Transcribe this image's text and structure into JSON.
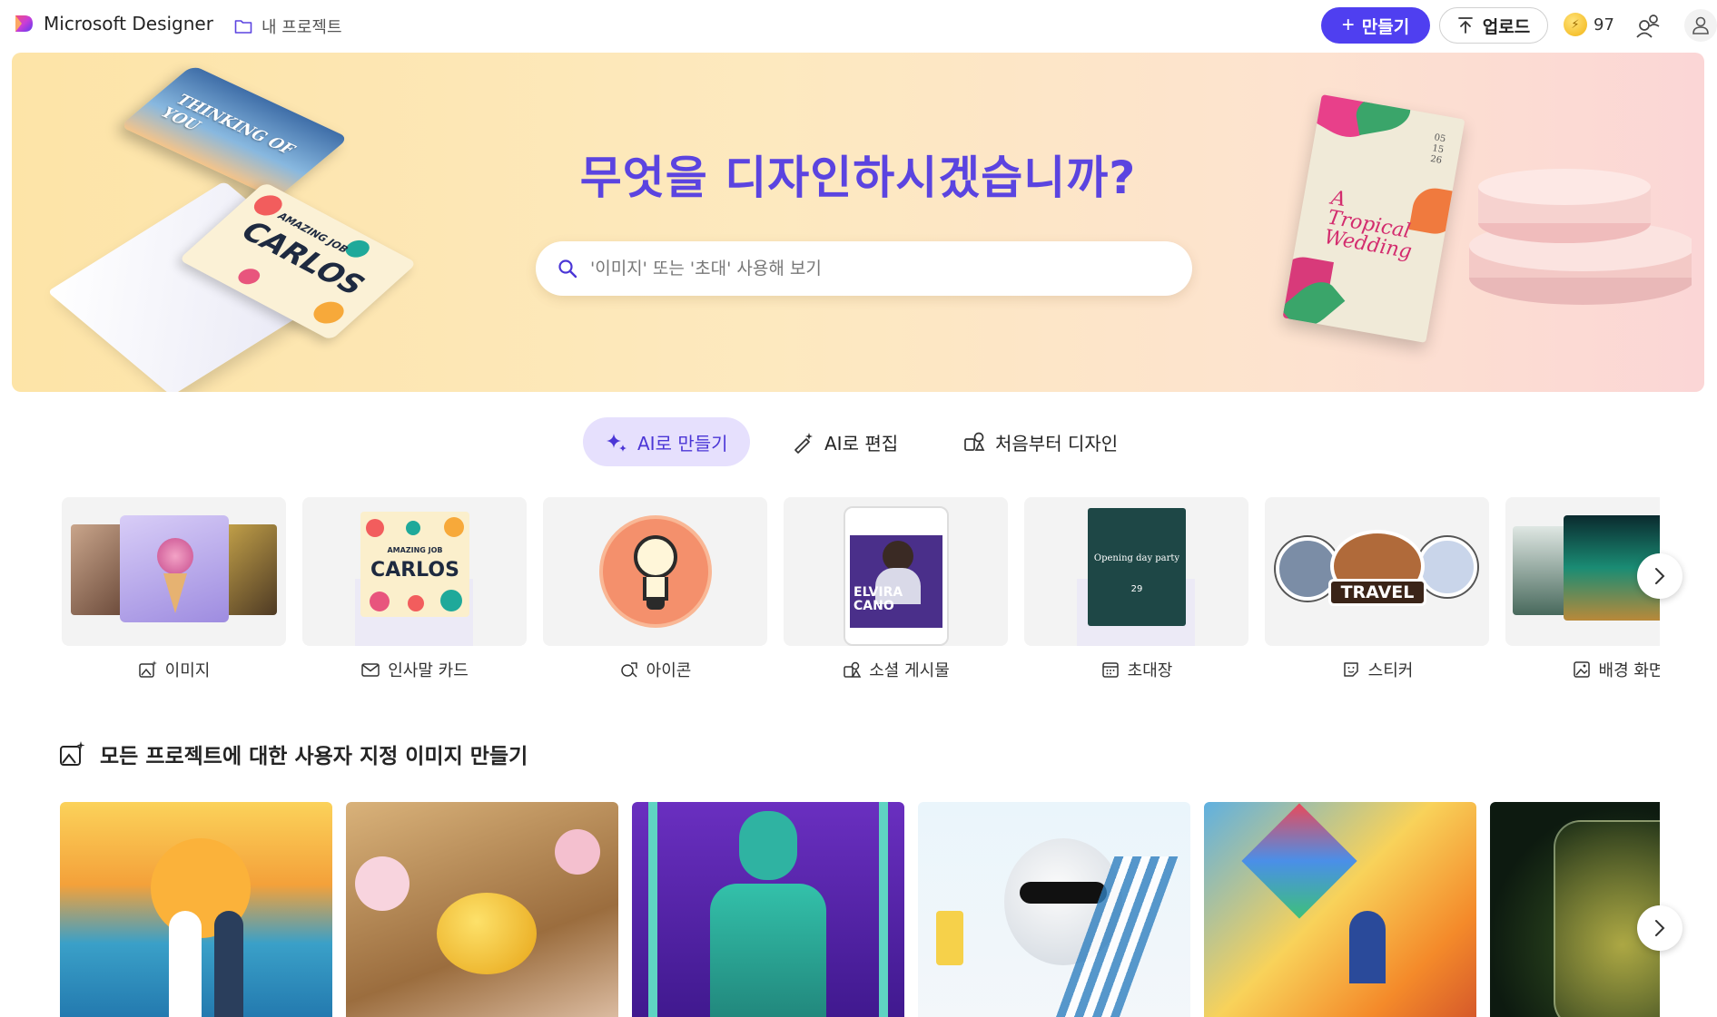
{
  "header": {
    "app_name": "Microsoft Designer",
    "my_projects": "내 프로젝트",
    "create_label": "만들기",
    "upload_label": "업로드",
    "credits": "97"
  },
  "hero": {
    "title": "무엇을 디자인하시겠습니까?",
    "search_placeholder": "'이미지' 또는 '초대' 사용해 보기",
    "card1_text": "THINKING OF YOU",
    "card2_small": "AMAZING JOB",
    "card2_big": "CARLOS",
    "invite_title": "A Tropical Wedding",
    "invite_date": "05 15 26"
  },
  "tabs": [
    {
      "label": "AI로 만들기",
      "active": true,
      "icon": "sparkle-icon"
    },
    {
      "label": "AI로 편집",
      "active": false,
      "icon": "magic-pen-icon"
    },
    {
      "label": "처음부터 디자인",
      "active": false,
      "icon": "shapes-icon"
    }
  ],
  "categories": [
    {
      "label": "이미지",
      "icon": "image-sparkle-icon"
    },
    {
      "label": "인사말 카드",
      "icon": "mail-icon"
    },
    {
      "label": "아이콘",
      "icon": "icon-shapes-icon"
    },
    {
      "label": "소셜 게시물",
      "icon": "social-post-icon"
    },
    {
      "label": "초대장",
      "icon": "calendar-icon"
    },
    {
      "label": "스티커",
      "icon": "sticker-icon"
    },
    {
      "label": "배경 화면",
      "icon": "wallpaper-icon"
    }
  ],
  "category_thumbs": {
    "greeting_small": "AMAZING JOB",
    "greeting_big": "CARLOS",
    "social_name": "ELVIRA CANO",
    "invite_text": "Opening day party",
    "invite_day": "29",
    "sticker_text": "TRAVEL"
  },
  "section": {
    "title": "모든 프로젝트에 대한 사용자 지정 이미지 만들기"
  },
  "colors": {
    "accent": "#4f3ff0",
    "hero_title": "#5b44e0",
    "active_tab_bg": "#e6e0fd"
  }
}
